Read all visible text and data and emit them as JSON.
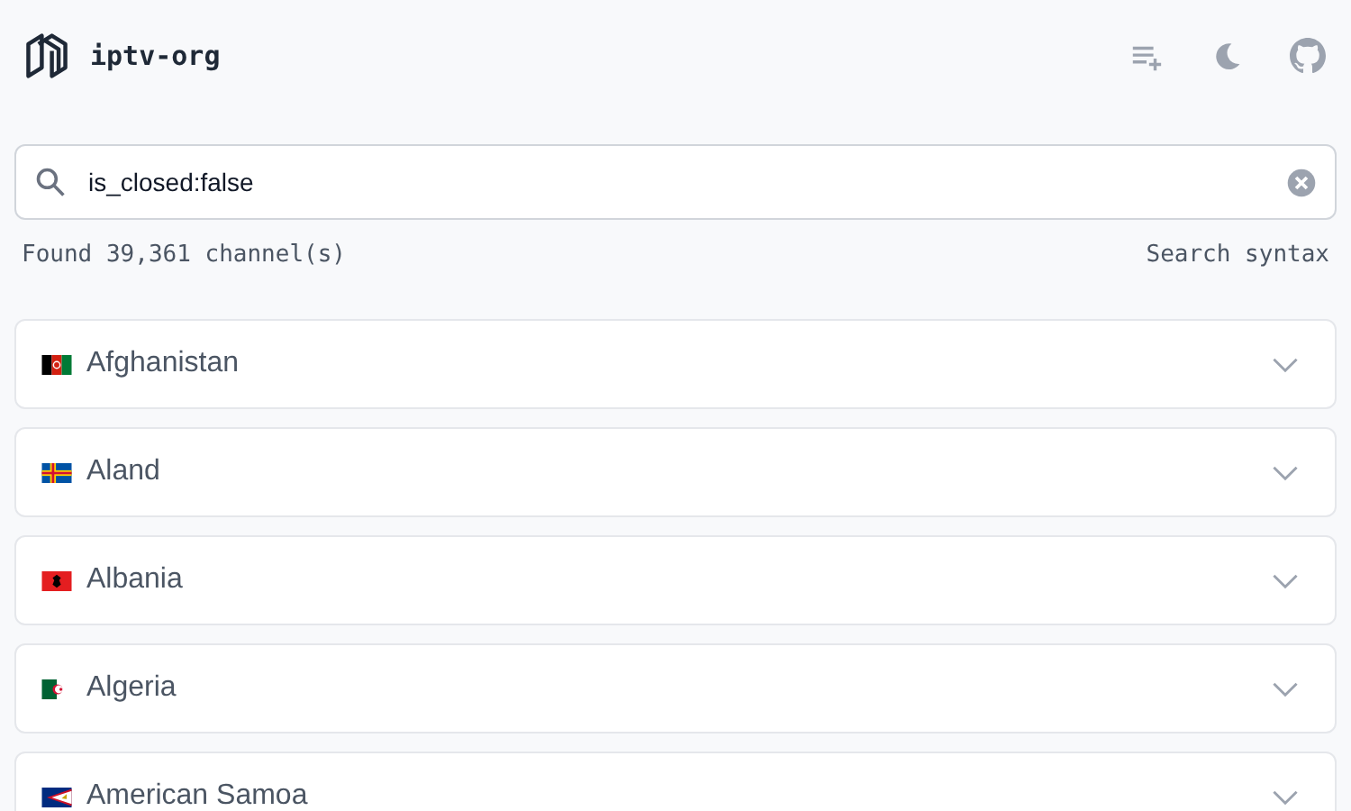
{
  "header": {
    "title": "iptv-org"
  },
  "search": {
    "value": "is_closed:false"
  },
  "results": {
    "count": "Found 39,361 channel(s)",
    "syntax_link": "Search syntax"
  },
  "countries": [
    {
      "name": "Afghanistan",
      "kind": "af",
      "expanded": false
    },
    {
      "name": "Aland",
      "kind": "ax",
      "expanded": false
    },
    {
      "name": "Albania",
      "kind": "al",
      "expanded": false
    },
    {
      "name": "Algeria",
      "kind": "dz",
      "expanded": false
    },
    {
      "name": "American Samoa",
      "kind": "as",
      "expanded": false
    }
  ]
}
